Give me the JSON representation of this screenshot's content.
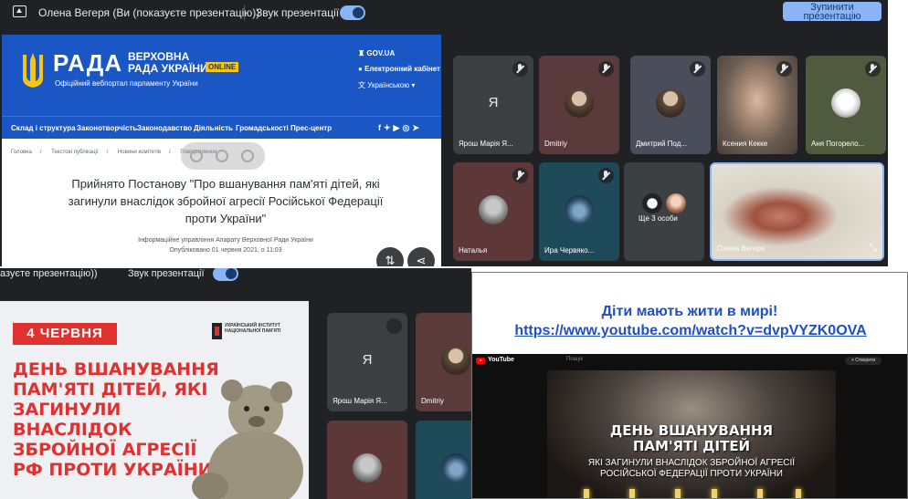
{
  "top": {
    "presenter": "Олена Вегеря (Ви (показуєте презентацію))",
    "sound_label": "Звук презентації",
    "stop_button": "Зупинити презентацію",
    "rada": {
      "logo": "РАДА",
      "title_line1": "ВЕРХОВНА",
      "title_line2": "РАДА УКРАЇНИ",
      "online_badge": "ONLINE",
      "portal_text": "Офіційний вебпортал парламенту України",
      "gov_link": "GOV.UA",
      "cabinet_link": "Електронний кабінет",
      "language": "Українською",
      "nav": [
        "Склад і структура",
        "Законотворчість",
        "Законодавство",
        "Діяльність",
        "Громадськості",
        "Прес-центр"
      ],
      "social_icons": [
        "facebook-icon",
        "twitter-icon",
        "youtube-icon",
        "instagram-icon",
        "telegram-icon"
      ],
      "breadcrumbs": [
        "Головна",
        "Текстові публікації",
        "Новини комітетів",
        "Повідомлення"
      ],
      "article_title": "Прийнято Постанову \"Про вшанування пам'яті дітей, які загинули внаслідок збройної агресії Російської Федерації проти України\"",
      "author": "Інформаційне управління Апарату Верховної Ради України",
      "published": "Опубліковано 01 червня 2021, о 11:03"
    },
    "tiles": [
      {
        "name": "Ярош Марія Я...",
        "avatar": "Я",
        "muted": true
      },
      {
        "name": "Dmitriy",
        "avatar": "",
        "muted": true
      },
      {
        "name": "Дмитрий Под...",
        "avatar": "",
        "muted": true
      },
      {
        "name": "Ксения Кекке",
        "avatar": "",
        "muted": true
      },
      {
        "name": "Аня Погорело...",
        "avatar": "",
        "muted": true
      },
      {
        "name": "Наталья",
        "avatar": "",
        "muted": true
      },
      {
        "name": "Ира Червяко...",
        "avatar": "",
        "muted": true
      },
      {
        "name": "Ще 3 особи",
        "avatar": "",
        "muted": false
      },
      {
        "name": "Олена Вегеря",
        "avatar": "",
        "muted": false
      }
    ]
  },
  "bottom": {
    "presenter": "азуєте презентацію))",
    "sound_label": "Звук презентації",
    "stop_fragment": "презентацію",
    "slide": {
      "date": "4 ЧЕРВНЯ",
      "institute": "УКРАЇНСЬКИЙ ІНСТИТУТ НАЦІОНАЛЬНОЇ ПАМ'ЯТІ",
      "headline": "ДЕНЬ ВШАНУВАННЯ ПАМ'ЯТІ ДІТЕЙ, ЯКІ ЗАГИНУЛИ ВНАСЛІДОК ЗБРОЙНОЇ АГРЕСІЇ РФ ПРОТИ УКРАЇНИ"
    },
    "tiles": [
      {
        "name": "Ярош Марія Я...",
        "avatar": "Я"
      },
      {
        "name": "Dmitriy",
        "avatar": ""
      }
    ]
  },
  "right": {
    "title": "Діти мають жити в мирі!",
    "link": "https://www.youtube.com/watch?v=dvpVYZK0OVA",
    "yt_name": "YouTube",
    "yt_search": "Пошук",
    "yt_create": "+ Створити",
    "video_title_line1": "ДЕНЬ ВШАНУВАННЯ",
    "video_title_line2": "ПАМ'ЯТІ ДІТЕЙ",
    "video_sub_line1": "ЯКІ ЗАГИНУЛИ ВНАСЛІДОК ЗБРОЙНОЇ АГРЕСІЇ",
    "video_sub_line2": "РОСІЙСЬКОЇ ФЕДЕРАЦІЇ ПРОТИ УКРАЇНИ"
  },
  "colors": {
    "meet_bg": "#202124",
    "meet_accent": "#8ab4f8",
    "rada_blue": "#1a56c4",
    "slide_red": "#e0312f",
    "link_blue": "#1f4fc4"
  }
}
